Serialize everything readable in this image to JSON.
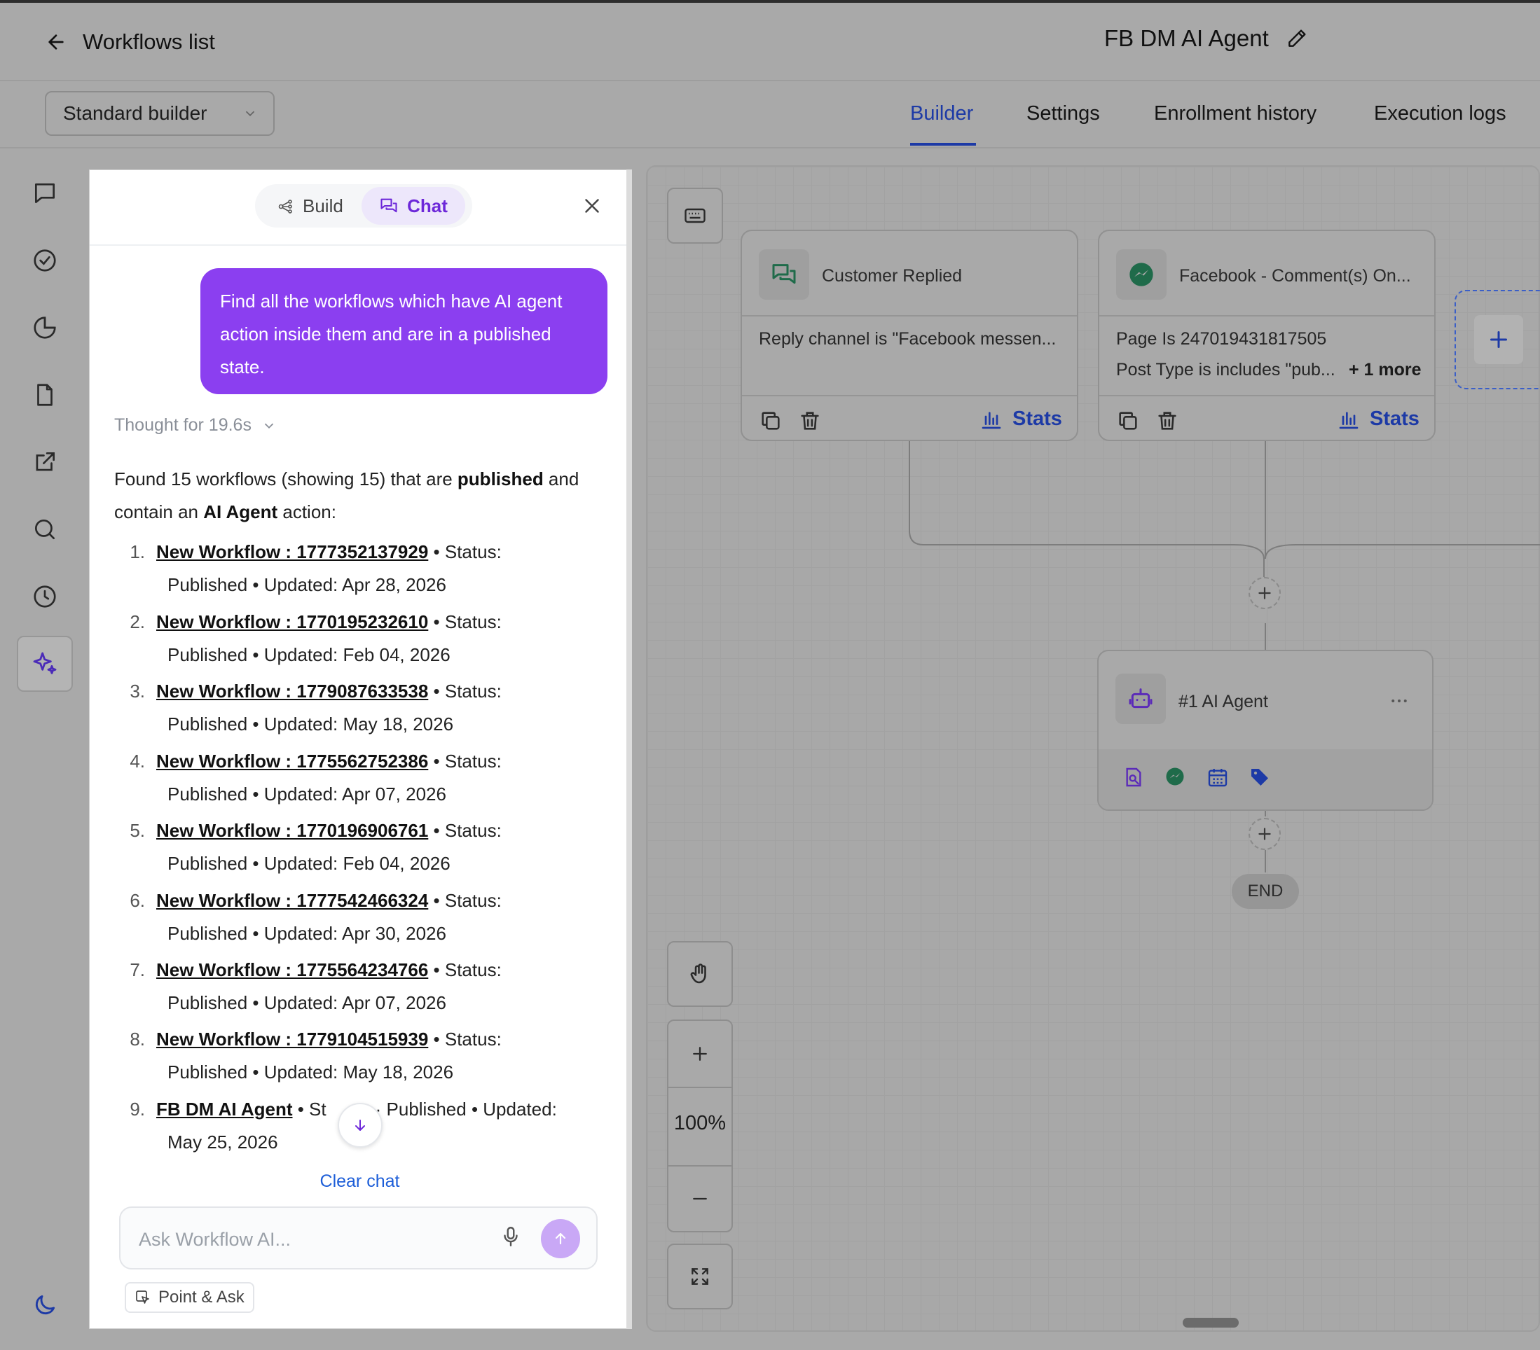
{
  "header": {
    "back_label": "Workflows list",
    "workflow_title": "FB DM AI Agent"
  },
  "subheader": {
    "builder_select": "Standard builder",
    "tabs": [
      {
        "label": "Builder",
        "active": true
      },
      {
        "label": "Settings",
        "active": false
      },
      {
        "label": "Enrollment history",
        "active": false
      },
      {
        "label": "Execution logs",
        "active": false
      }
    ]
  },
  "rail": {
    "icons": [
      "chat-bubble-icon",
      "check-circle-icon",
      "pie-chart-icon",
      "document-icon",
      "external-link-icon",
      "search-icon",
      "history-icon",
      "sparkles-icon",
      "moon-icon"
    ],
    "active": "sparkles-icon"
  },
  "chat": {
    "tabs": {
      "build": "Build",
      "chat": "Chat",
      "active": "Chat"
    },
    "user_message": "Find all the workflows which have AI agent action inside them and are in a published state.",
    "thought": "Thought for 19.6s",
    "intro": {
      "p1": "Found 15 workflows (showing 15) that are ",
      "b1": "published",
      "p2": " and contain an ",
      "b2": "AI Agent",
      "p3": " action:"
    },
    "results": [
      {
        "num": "1.",
        "name": "New Workflow : 1777352137929",
        "status_label": "• Status:",
        "rest": "Published • Updated: Apr 28, 2026"
      },
      {
        "num": "2.",
        "name": "New Workflow : 1770195232610",
        "status_label": "• Status:",
        "rest": "Published • Updated: Feb 04, 2026"
      },
      {
        "num": "3.",
        "name": "New Workflow : 1779087633538",
        "status_label": "• Status:",
        "rest": "Published • Updated: May 18, 2026"
      },
      {
        "num": "4.",
        "name": "New Workflow : 1775562752386",
        "status_label": "• Status:",
        "rest": "Published • Updated: Apr 07, 2026"
      },
      {
        "num": "5.",
        "name": "New Workflow : 1770196906761",
        "status_label": "• Status:",
        "rest": "Published • Updated: Feb 04, 2026"
      },
      {
        "num": "6.",
        "name": "New Workflow : 1777542466324",
        "status_label": "• Status:",
        "rest": "Published • Updated: Apr 30, 2026"
      },
      {
        "num": "7.",
        "name": "New Workflow : 1775564234766",
        "status_label": "• Status:",
        "rest": "Published • Updated: Apr 07, 2026"
      },
      {
        "num": "8.",
        "name": "New Workflow : 1779104515939",
        "status_label": "• Status:",
        "rest": "Published • Updated: May 18, 2026"
      },
      {
        "num": "9.",
        "name": "FB DM AI Agent",
        "status_label": "• St",
        "status_tail": "· Published • Updated:",
        "rest": "May 25, 2026"
      }
    ],
    "clear_chat": "Clear chat",
    "input_placeholder": "Ask Workflow AI...",
    "point_ask": "Point & Ask"
  },
  "canvas": {
    "triggers": [
      {
        "title": "Customer Replied",
        "lines": [
          "Reply channel is \"Facebook messen..."
        ],
        "stats": "Stats",
        "icon": "chat-replied-icon"
      },
      {
        "title": "Facebook - Comment(s) On...",
        "lines": [
          "Page Is 247019431817505",
          "Post Type is includes \"pub..."
        ],
        "more": "+ 1 more",
        "stats": "Stats",
        "icon": "messenger-icon"
      }
    ],
    "action": {
      "title": "#1 AI Agent",
      "icon": "robot-icon",
      "tool_icons": [
        "knowledge-base-icon",
        "messenger-icon",
        "calendar-icon",
        "tag-icon"
      ]
    },
    "end_label": "END",
    "zoom": "100%",
    "colors": {
      "accent": "#1d3aa6",
      "chat_purple": "#8b3ff0",
      "messenger_green": "#1f6b4a"
    }
  }
}
